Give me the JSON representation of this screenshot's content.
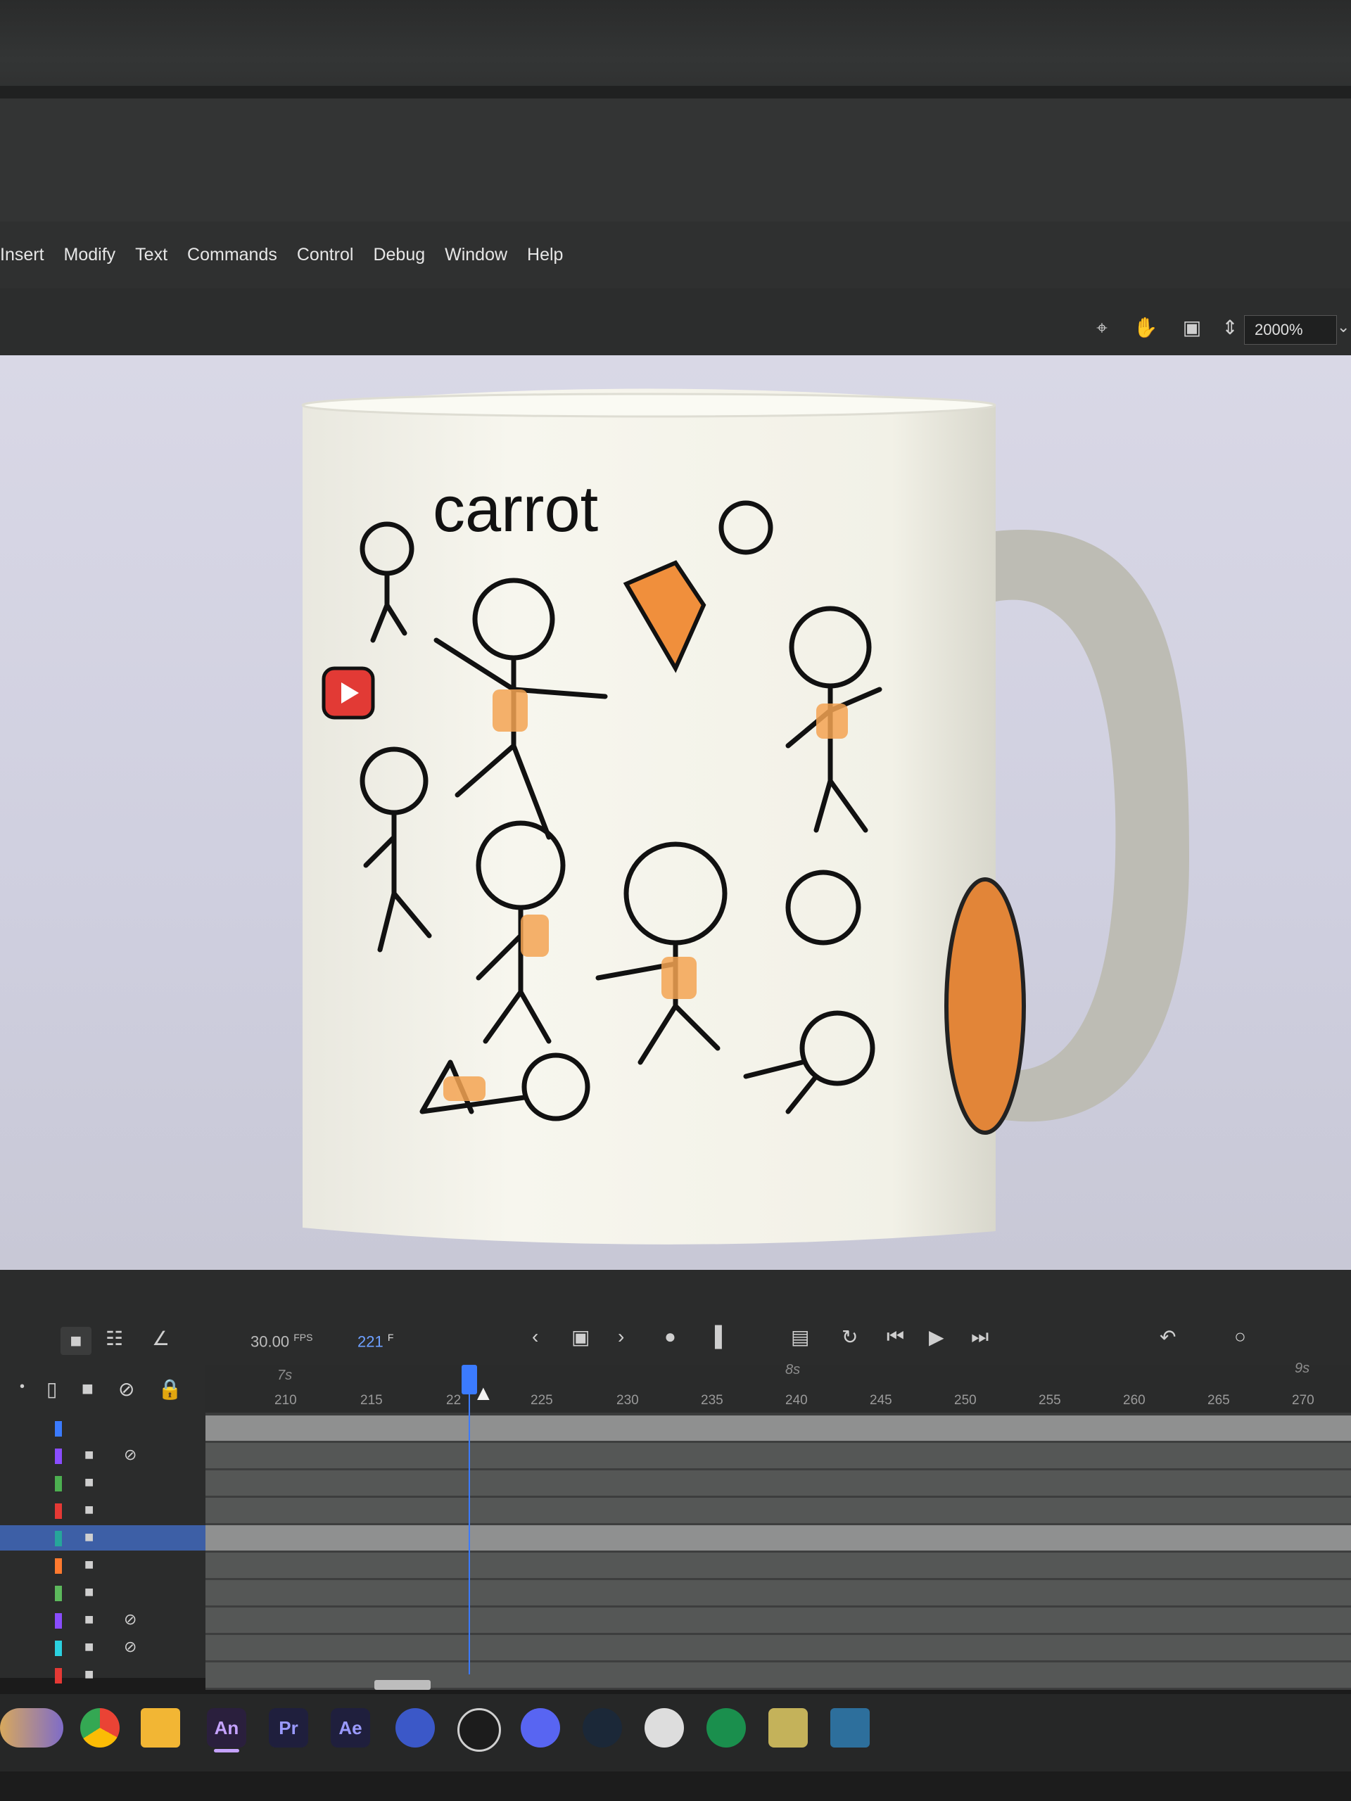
{
  "menu": {
    "items": [
      "Insert",
      "Modify",
      "Text",
      "Commands",
      "Control",
      "Debug",
      "Window",
      "Help"
    ]
  },
  "toolbar": {
    "icons": [
      "crosshair-icon",
      "hand-icon",
      "frame-icon",
      "stepper-icon"
    ],
    "zoom": "2000%"
  },
  "stage": {
    "mug_text": "carrot"
  },
  "timeline": {
    "fps": "30.00",
    "fps_unit": "FPS",
    "current_frame": "221",
    "frame_unit": "F",
    "ruler_ticks": [
      "210",
      "215",
      "22",
      "225",
      "230",
      "235",
      "240",
      "245",
      "250",
      "255",
      "260",
      "265",
      "270"
    ],
    "second_markers": [
      "7s",
      "8s",
      "9s"
    ],
    "layer_colors": [
      "#3b7bff",
      "#8a4dff",
      "#4caf50",
      "#e53935",
      "#26a69a",
      "#ff7a2f",
      "#5cb85c",
      "#8a4dff",
      "#2bd1e0",
      "#e53935"
    ]
  },
  "taskbar": {
    "apps": [
      {
        "label": "An",
        "color": "#c5a2ff",
        "bg": "#2a1f3d"
      },
      {
        "label": "Pr",
        "color": "#9a9aff",
        "bg": "#1f1f3d"
      },
      {
        "label": "Ae",
        "color": "#9a9aff",
        "bg": "#1f1f3d"
      }
    ]
  }
}
